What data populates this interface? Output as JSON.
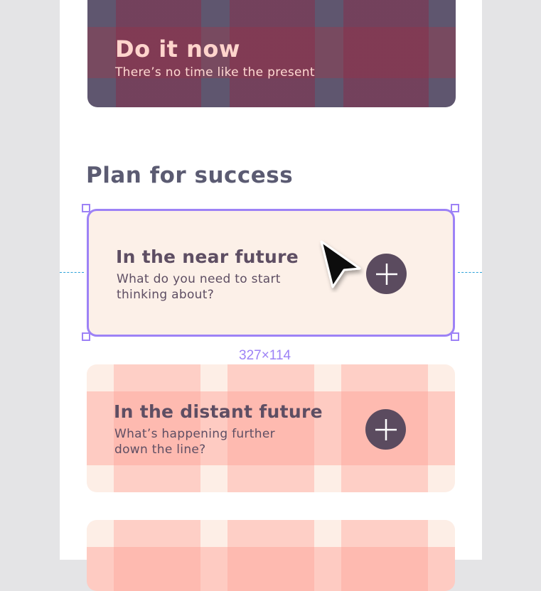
{
  "cards": {
    "now": {
      "title": "Do it now",
      "subtitle": "There’s no time like the present"
    },
    "near": {
      "title": "In the near future",
      "description": "What do you need to start thinking about?"
    },
    "far": {
      "title": "In the distant future",
      "description": "What’s happening further down the line?"
    }
  },
  "section": {
    "title": "Plan for success"
  },
  "selection": {
    "dimensions": "327×114"
  },
  "icons": {
    "add": "plus-icon",
    "cursor": "pointer-cursor-icon"
  },
  "colors": {
    "selection": "#9d82f6",
    "guide": "#2aa0d8",
    "button": "#5b4b5f",
    "heading": "#5b5b72"
  }
}
